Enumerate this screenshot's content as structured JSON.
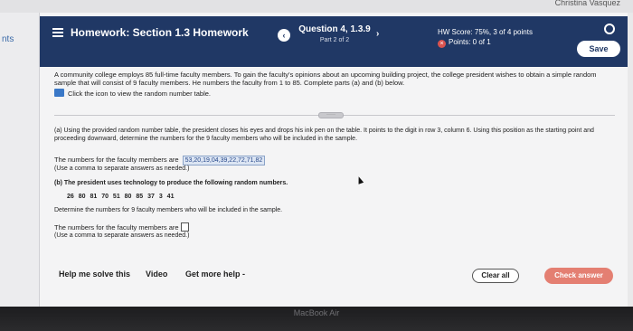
{
  "top": {
    "user_name": "Christina Vasquez"
  },
  "left_sliver": {
    "text": "nts"
  },
  "header": {
    "hw_title": "Homework: Section 1.3 Homework",
    "question": "Question 4, 1.3.9",
    "part": "Part 2 of 2",
    "prev": "‹",
    "next": "›",
    "score": "HW Score: 75%, 3 of 4 points",
    "points": "Points: 0 of 1",
    "points_icon": "×",
    "save": "Save"
  },
  "question": {
    "intro": "A community college employs 85 full-time faculty members. To gain the faculty's opinions about an upcoming building project, the college president wishes to obtain a simple random sample that will consist of 9 faculty members. He numbers the faculty from 1 to 85. Complete parts (a) and (b) below.",
    "table_link": "Click the icon to view the random number table.",
    "divider_handle": "·····"
  },
  "part_a": {
    "text": "(a) Using the provided random number table, the president closes his eyes and drops his ink pen on the table. It points to the digit in row 3, column 6. Using this position as the starting point and proceeding downward, determine the numbers for the 9 faculty members who will be included in the sample.",
    "answer_label": "The numbers for the faculty members are",
    "answer_value": "53,20,19,04,39,22,72,71,82",
    "hint": "(Use a comma to separate answers as needed.)"
  },
  "part_b": {
    "title": "(b) The president uses technology to produce the following random numbers.",
    "numbers": "26 80 81 70 51 80 85 37 3 41",
    "determine": "Determine the numbers for 9 faculty members who will be included in the sample.",
    "answer_label": "The numbers for the faculty members are",
    "hint": "(Use a comma to separate answers as needed.)"
  },
  "footer": {
    "help_solve": "Help me solve this",
    "video": "Video",
    "more_help": "Get more help -",
    "clear_all": "Clear all",
    "check_answer": "Check answer"
  },
  "bezel": {
    "text": "MacBook Air"
  },
  "colors": {
    "header_bg": "#203865",
    "check_answer_bg": "#e47f72",
    "answer_box_bg": "#dce5f3"
  }
}
